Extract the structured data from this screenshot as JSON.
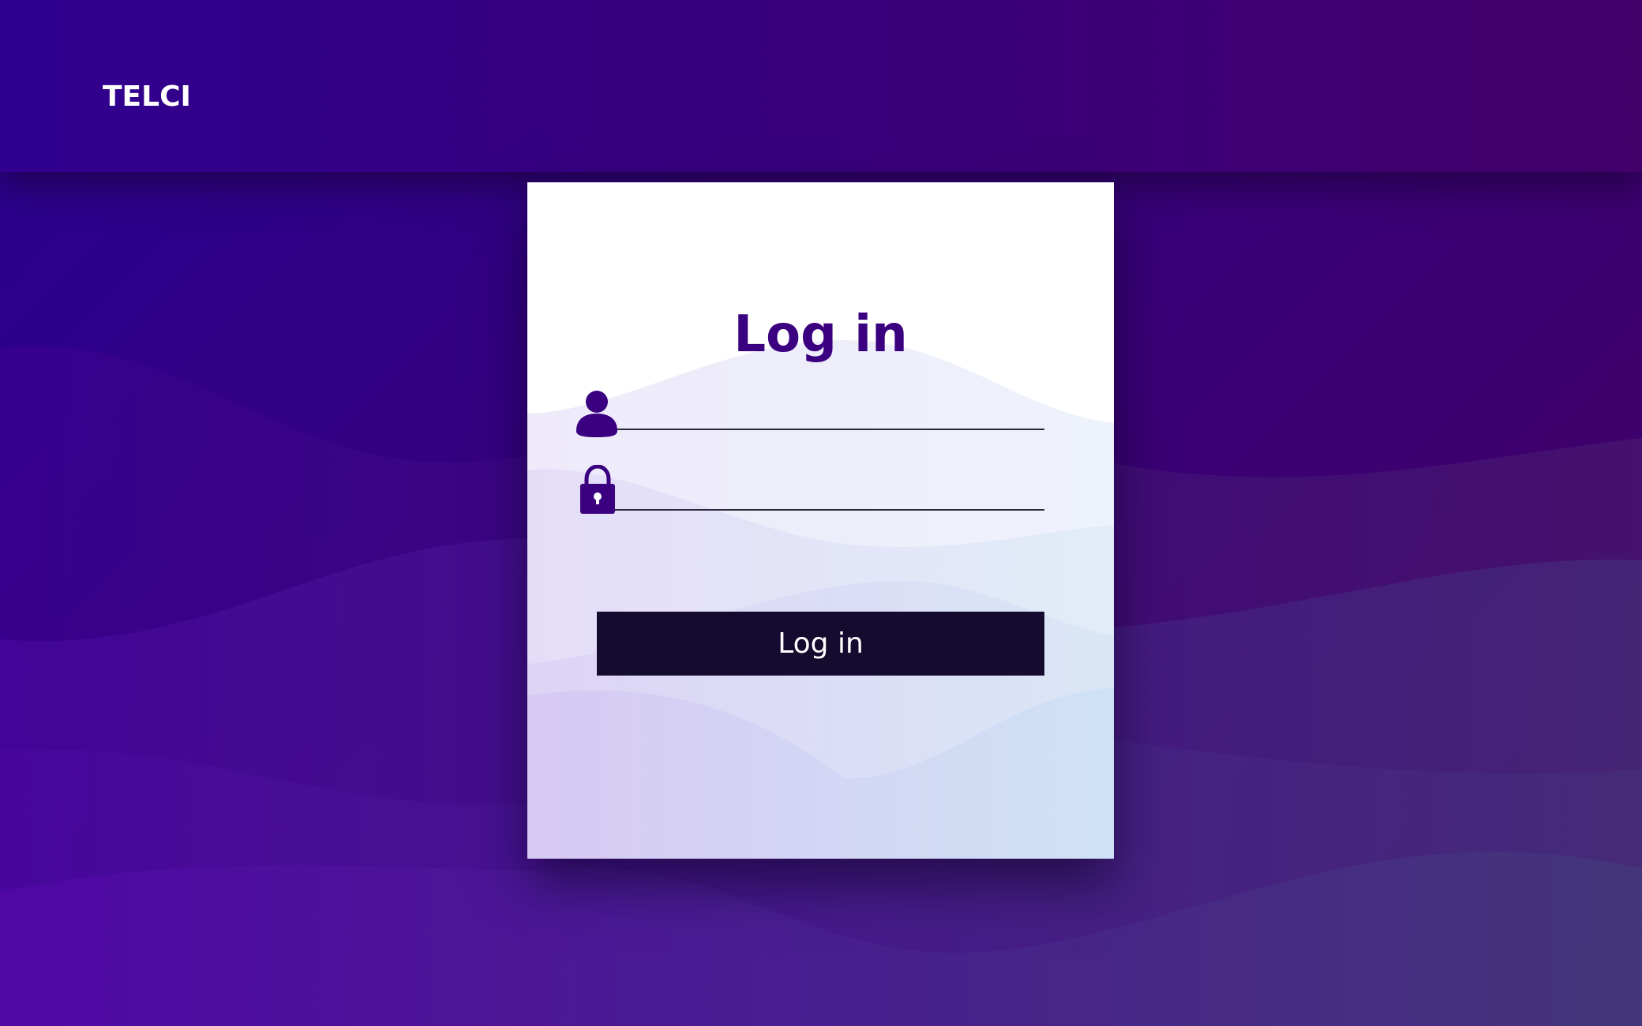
{
  "brand": {
    "name": "TELCI"
  },
  "login_card": {
    "title": "Log in",
    "username": {
      "value": "",
      "placeholder": "",
      "icon": "user-icon"
    },
    "password": {
      "value": "",
      "placeholder": "",
      "icon": "lock-icon"
    },
    "submit_label": "Log in"
  },
  "colors": {
    "background_start": "#2a0090",
    "background_end": "#420060",
    "title": "#3a0080",
    "button_bg": "#150b2e",
    "button_text": "#ffffff",
    "brand_text": "#ffffff"
  }
}
